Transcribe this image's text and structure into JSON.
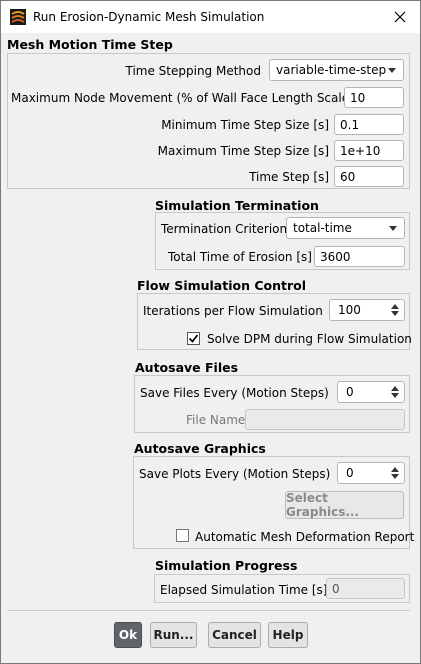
{
  "window": {
    "title": "Run Erosion-Dynamic Mesh Simulation"
  },
  "mesh_motion": {
    "title": "Mesh Motion Time Step",
    "time_stepping_method": {
      "label": "Time Stepping Method",
      "value": "variable-time-step"
    },
    "max_node_movement": {
      "label": "Maximum Node Movement (% of Wall Face Length Scale)",
      "value": "10"
    },
    "min_time_step": {
      "label": "Minimum Time Step Size [s]",
      "value": "0.1"
    },
    "max_time_step": {
      "label": "Maximum Time Step Size [s]",
      "value": "1e+10"
    },
    "time_step": {
      "label": "Time Step [s]",
      "value": "60"
    }
  },
  "sim_termination": {
    "title": "Simulation Termination",
    "criterion": {
      "label": "Termination Criterion",
      "value": "total-time"
    },
    "total_time": {
      "label": "Total Time of Erosion [s]",
      "value": "3600"
    }
  },
  "flow_control": {
    "title": "Flow Simulation Control",
    "iterations": {
      "label": "Iterations per Flow Simulation",
      "value": "100"
    },
    "solve_dpm": {
      "label": "Solve DPM during Flow Simulation",
      "checked": true
    }
  },
  "autosave_files": {
    "title": "Autosave Files",
    "save_every": {
      "label": "Save Files Every (Motion Steps)",
      "value": "0"
    },
    "file_name": {
      "label": "File Name",
      "value": ""
    }
  },
  "autosave_graphics": {
    "title": "Autosave Graphics",
    "save_plots": {
      "label": "Save Plots Every (Motion Steps)",
      "value": "0"
    },
    "select_graphics_label": "Select Graphics...",
    "auto_report": {
      "label": "Automatic Mesh Deformation Report",
      "checked": false
    }
  },
  "progress": {
    "title": "Simulation Progress",
    "elapsed": {
      "label": "Elapsed Simulation Time [s]",
      "value": "0"
    }
  },
  "buttons": {
    "ok": "Ok",
    "run": "Run...",
    "cancel": "Cancel",
    "help": "Help"
  },
  "colors": {
    "primary_button": "#5f656b",
    "window_bg": "#f0f0f0",
    "group_border": "#c8c8c8"
  }
}
